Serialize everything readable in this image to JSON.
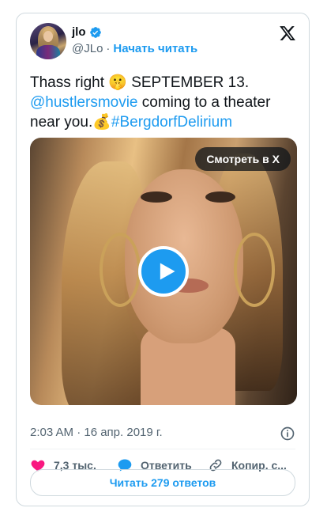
{
  "author": {
    "name": "jlo",
    "handle": "@JLo",
    "separator": "·",
    "follow_label": "Начать читать",
    "verified_icon": "verified-badge-icon",
    "brand_icon": "x-logo-icon"
  },
  "tweet": {
    "part1": "Thass right ",
    "emoji1": "🤫",
    "part2": " SEPTEMBER 13.",
    "mention": "@hustlersmovie",
    "part3": " coming to a theater near you.",
    "emoji2": "💰",
    "hashtag": "#BergdorfDelirium"
  },
  "media": {
    "watch_label": "Смотреть в X",
    "play_icon": "play-icon"
  },
  "meta": {
    "timestamp": "2:03 AM · 16 апр. 2019 г.",
    "info_icon": "info-icon"
  },
  "actions": {
    "like_count": "7,3 тыс.",
    "reply_label": "Ответить",
    "copy_label": "Копир. с..."
  },
  "read_replies_label": "Читать 279 ответов",
  "colors": {
    "accent": "#1d9bf0",
    "like": "#f91880",
    "text": "#0f1419",
    "muted": "#536471",
    "border": "#cfd9de"
  }
}
